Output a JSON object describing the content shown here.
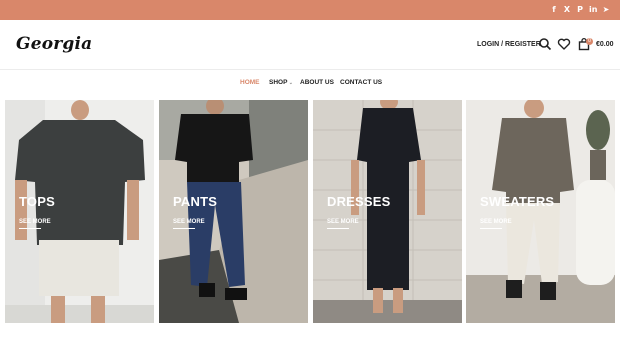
{
  "brand": {
    "logo_text": "Georgia",
    "accent": "#d9876a"
  },
  "topbar": {
    "social": [
      {
        "icon": "facebook-icon",
        "glyph": "f"
      },
      {
        "icon": "x-twitter-icon",
        "glyph": "X"
      },
      {
        "icon": "pinterest-icon",
        "glyph": "P"
      },
      {
        "icon": "linkedin-icon",
        "glyph": "in"
      },
      {
        "icon": "telegram-icon",
        "glyph": "➤"
      }
    ]
  },
  "header": {
    "login_label": "LOGIN / REGISTER",
    "search_icon": "search-icon",
    "wishlist_icon": "heart-icon",
    "cart_icon": "shopping-bag-icon",
    "cart_count": "0",
    "cart_total": "€0.00"
  },
  "nav": {
    "items": [
      {
        "label": "HOME",
        "active": true
      },
      {
        "label": "SHOP",
        "has_dropdown": true
      },
      {
        "label": "ABOUT US"
      },
      {
        "label": "CONTACT US"
      }
    ]
  },
  "categories": [
    {
      "title": "TOPS",
      "link": "SEE MORE"
    },
    {
      "title": "PANTS",
      "link": "SEE MORE"
    },
    {
      "title": "DRESSES",
      "link": "SEE MORE"
    },
    {
      "title": "SWEATERS",
      "link": "SEE MORE"
    }
  ]
}
